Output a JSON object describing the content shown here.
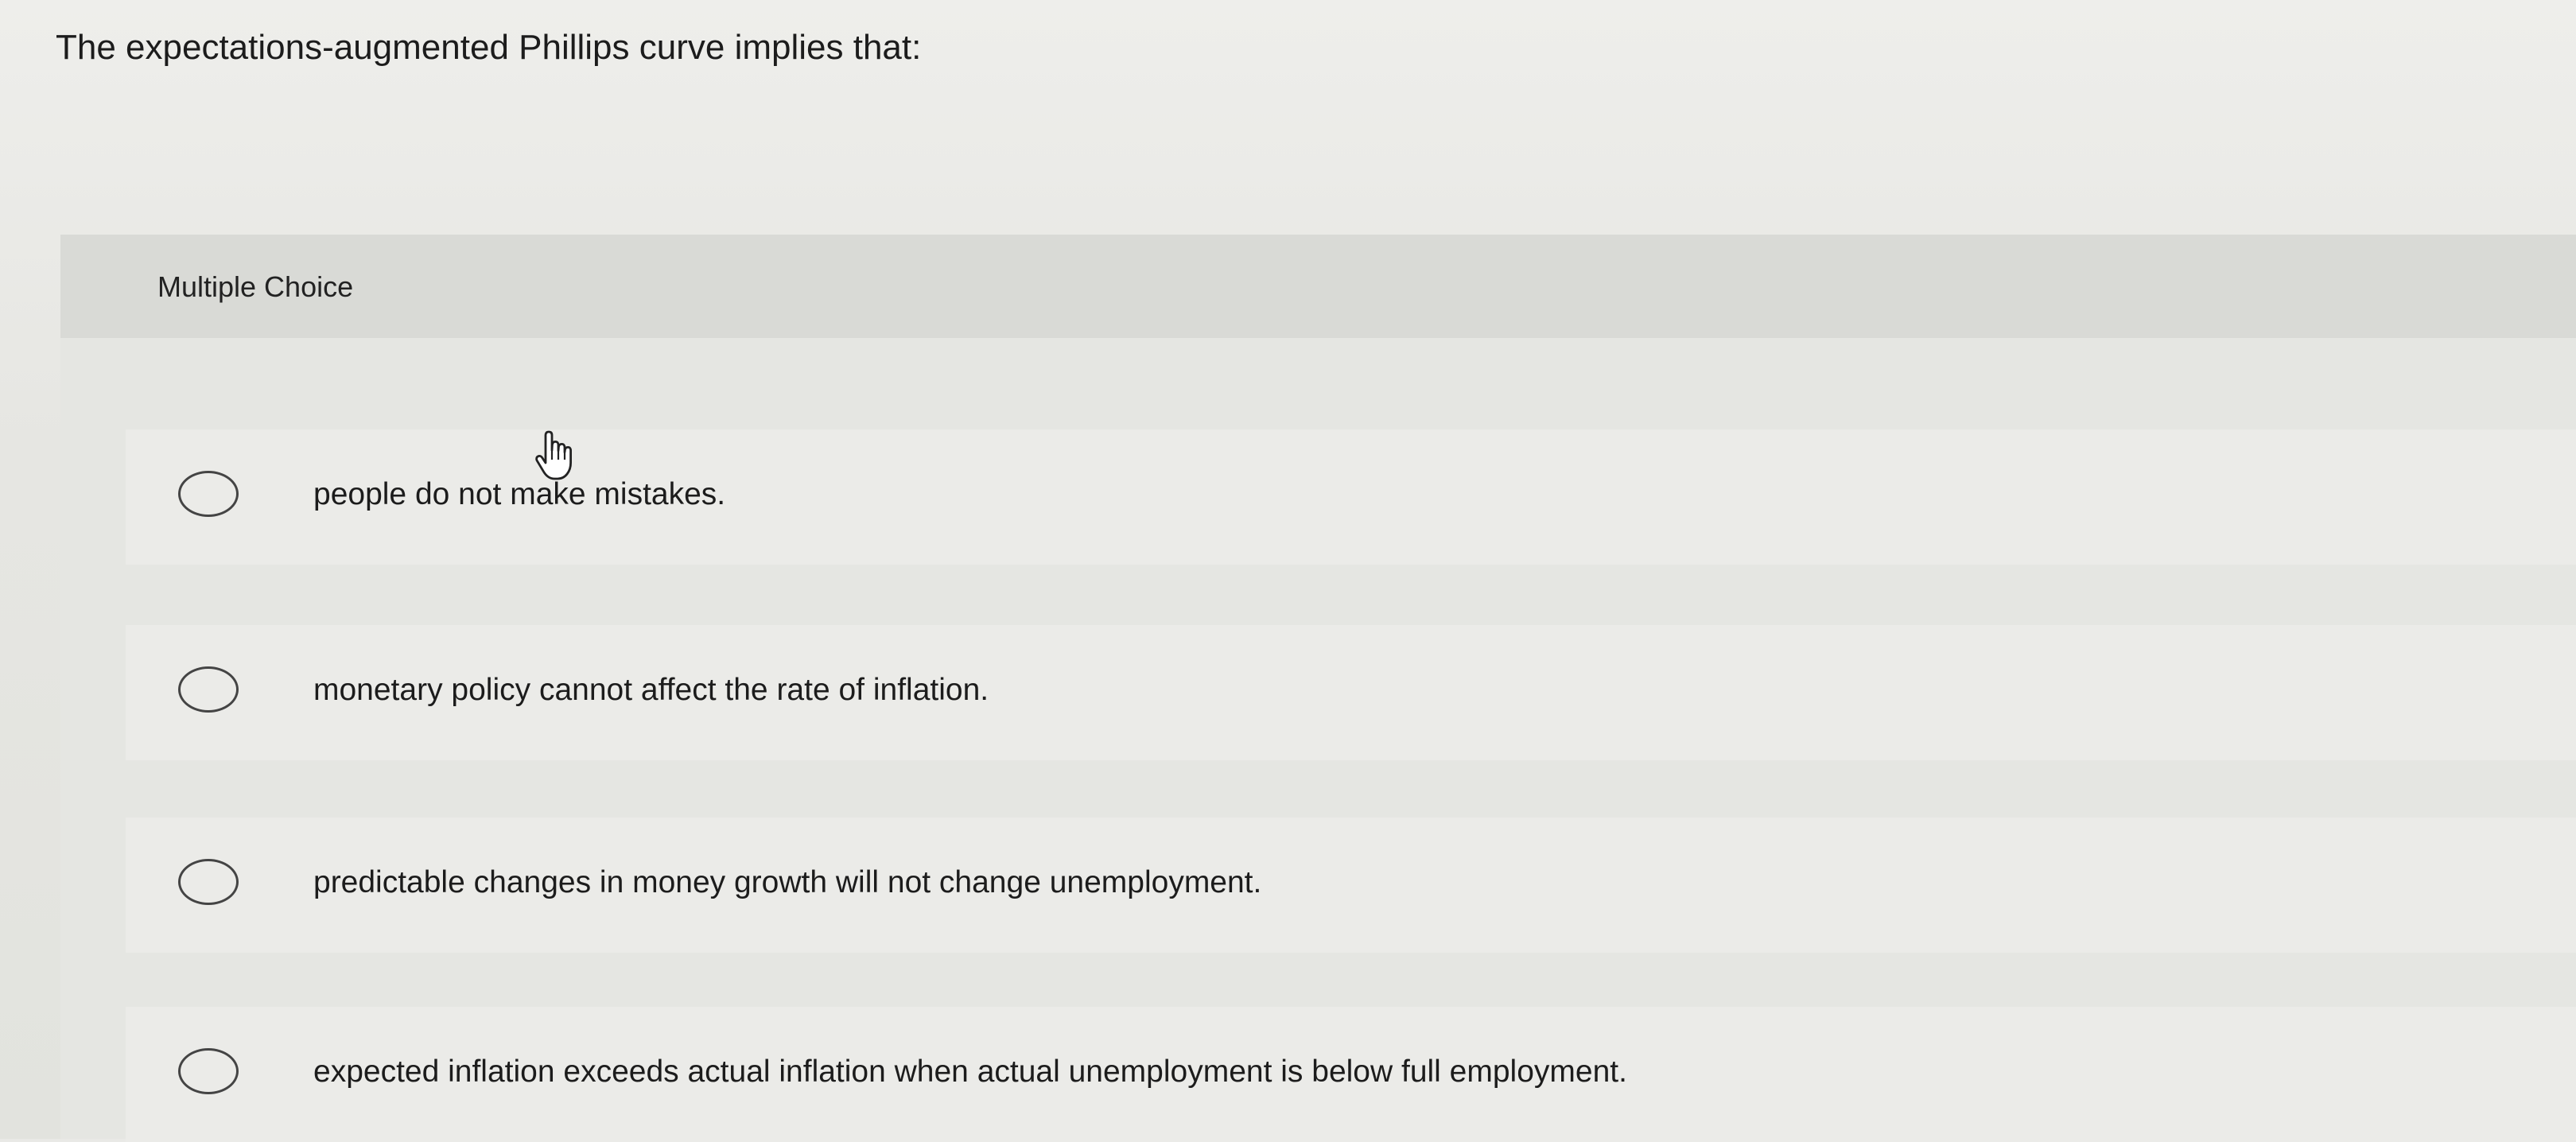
{
  "question": {
    "text": "The expectations-augmented Phillips curve implies that:"
  },
  "multiple_choice": {
    "label": "Multiple Choice",
    "options": [
      {
        "label": "people do not make mistakes.",
        "selected": false
      },
      {
        "label": "monetary policy cannot affect the rate of inflation.",
        "selected": false
      },
      {
        "label": "predictable changes in money growth will not change unemployment.",
        "selected": false
      },
      {
        "label": "expected inflation exceeds actual inflation when actual unemployment is below full employment.",
        "selected": false
      }
    ]
  },
  "cursor": {
    "icon": "hand-pointer-icon"
  }
}
